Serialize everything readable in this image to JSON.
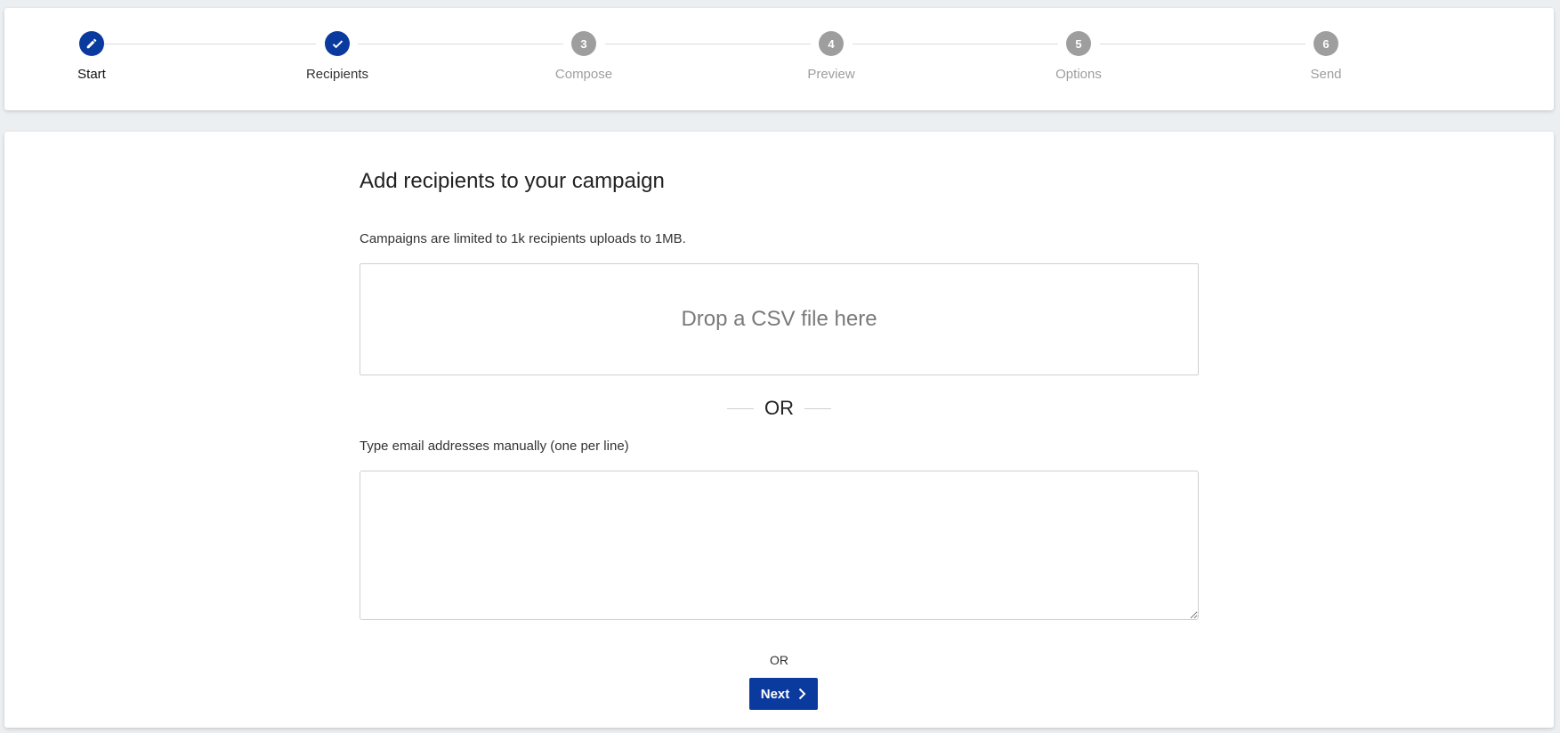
{
  "stepper": {
    "steps": [
      {
        "number": "",
        "label": "Start",
        "state": "current",
        "icon": "pencil-icon"
      },
      {
        "number": "",
        "label": "Recipients",
        "state": "done",
        "icon": "check-icon"
      },
      {
        "number": "3",
        "label": "Compose",
        "state": "pending"
      },
      {
        "number": "4",
        "label": "Preview",
        "state": "pending"
      },
      {
        "number": "5",
        "label": "Options",
        "state": "pending"
      },
      {
        "number": "6",
        "label": "Send",
        "state": "pending"
      }
    ]
  },
  "main": {
    "title": "Add recipients to your campaign",
    "limit_text": "Campaigns are limited to 1k recipients uploads to 1MB.",
    "dropzone_text": "Drop a CSV file here",
    "or_divider": "OR",
    "manual_label": "Type email addresses manually (one per line)",
    "email_textarea_value": "",
    "or_small": "OR",
    "next_button_label": "Next"
  },
  "colors": {
    "accent": "#0a3a9e",
    "inactive_step": "#9e9e9e",
    "background": "#eceff1"
  }
}
